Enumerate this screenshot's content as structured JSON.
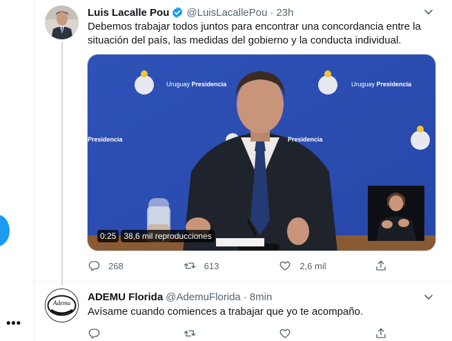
{
  "sidebar": {
    "more_label": "•••",
    "fab_color": "#1d9bf0"
  },
  "tweets": [
    {
      "author": {
        "name": "Luis Lacalle Pou",
        "handle": "@LuisLacallePou",
        "verified": true
      },
      "separator": "·",
      "time": "23h",
      "text": "Debemos trabajar todos juntos para encontrar una concordancia entre la situación del país, las medidas del gobierno y la conducta individual.",
      "media": {
        "type": "video",
        "brand_light": "Uruguay",
        "brand_bold": "Presidencia",
        "duration": "0:25",
        "views": "38,6 mil reproducciones"
      },
      "actions": {
        "replies": "268",
        "retweets": "613",
        "likes": "2,6 mil"
      }
    },
    {
      "author": {
        "name": "ADEMU Florida",
        "handle": "@AdemuFlorida",
        "verified": false,
        "avatar_text": "Ademu"
      },
      "separator": "·",
      "time": "8min",
      "text": "Avísame cuando comiences a trabajar que yo te acompaño.",
      "actions": {
        "replies": "",
        "retweets": "",
        "likes": ""
      }
    }
  ],
  "colors": {
    "accent": "#1d9bf0",
    "text_secondary": "#536471",
    "video_bg": "#2b4bb0"
  },
  "icons": [
    "reply-icon",
    "retweet-icon",
    "like-icon",
    "share-icon",
    "verified-badge-icon",
    "caret-down-icon"
  ]
}
